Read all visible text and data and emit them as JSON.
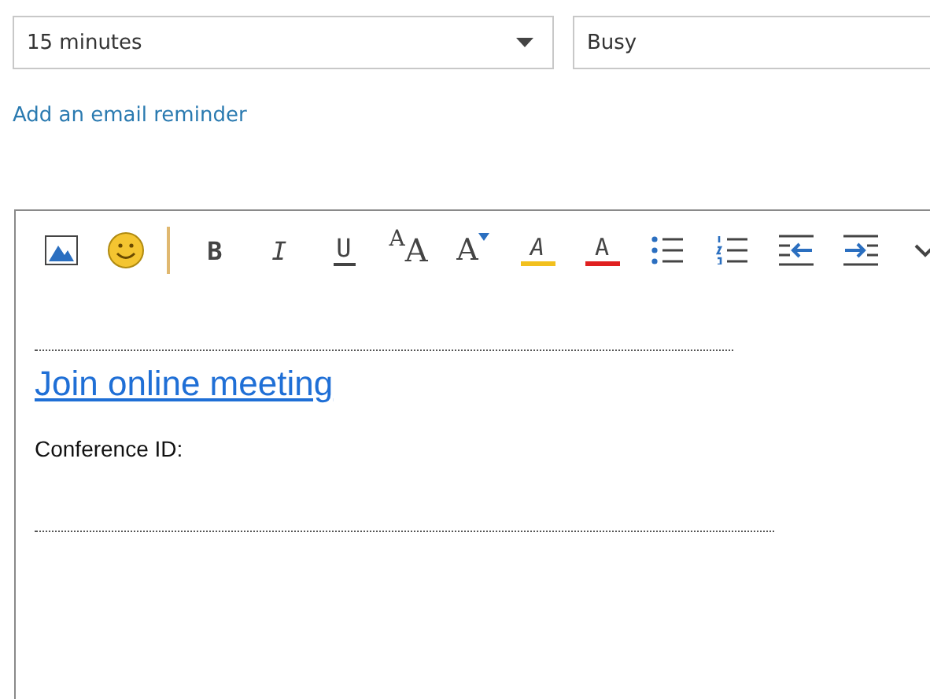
{
  "reminder": {
    "value": "15 minutes"
  },
  "show_as": {
    "value": "Busy"
  },
  "email_reminder_link": "Add an email reminder",
  "toolbar": [
    {
      "kind": "picture"
    },
    {
      "kind": "emoji"
    },
    {
      "kind": "separator"
    },
    {
      "kind": "bold",
      "label": "B"
    },
    {
      "kind": "italic",
      "label": "I"
    },
    {
      "kind": "underline",
      "label": "U"
    },
    {
      "kind": "font-size",
      "label": "A",
      "label_2": "A"
    },
    {
      "kind": "grow",
      "label": "A"
    },
    {
      "kind": "highlight",
      "label": "A"
    },
    {
      "kind": "font-color",
      "label": "A"
    },
    {
      "kind": "bullets"
    },
    {
      "kind": "numbering"
    },
    {
      "kind": "outdent"
    },
    {
      "kind": "indent"
    },
    {
      "kind": "more"
    }
  ],
  "body": {
    "meeting_link": "Join online meeting",
    "conference_label": "Conference ID:"
  }
}
